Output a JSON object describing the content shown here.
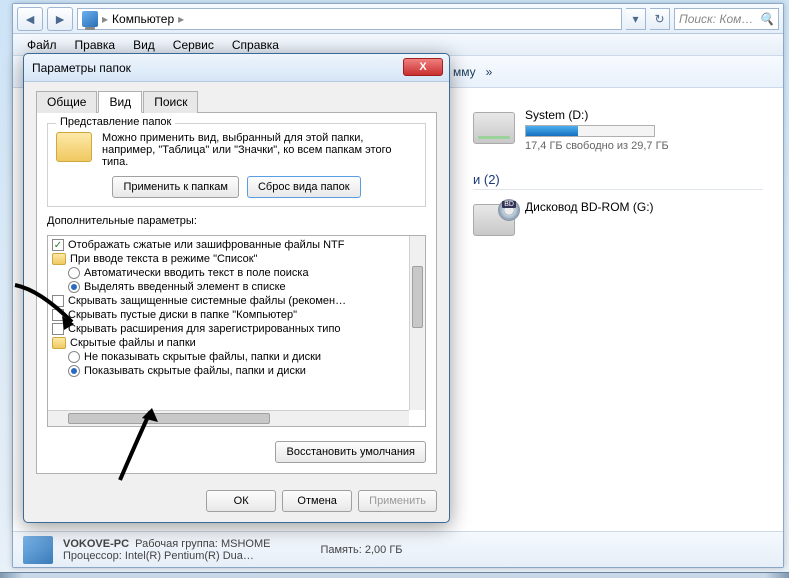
{
  "address": {
    "location": "Компьютер",
    "chevron": "▸"
  },
  "search": {
    "placeholder": "Поиск: Ком…"
  },
  "menu": {
    "file": "Файл",
    "edit": "Правка",
    "view": "Вид",
    "tools": "Сервис",
    "help": "Справка"
  },
  "toolbar": {
    "overflow": "»"
  },
  "groups": {
    "devices": "и (2)"
  },
  "driveD": {
    "name": "System (D:)",
    "free": "17,4 ГБ свободно из 29,7 ГБ",
    "usedPercent": 41
  },
  "driveG": {
    "name": "Дисковод BD-ROM (G:)"
  },
  "status": {
    "name": "VOKOVE-PC",
    "workgroupLabel": "Рабочая группа:",
    "workgroup": "MSHOME",
    "cpuLabel": "Процессор:",
    "cpu": "Intel(R) Pentium(R) Dua…",
    "ramLabel": "Память:",
    "ram": "2,00 ГБ"
  },
  "dialog": {
    "title": "Параметры папок",
    "tabs": {
      "general": "Общие",
      "view": "Вид",
      "search": "Поиск"
    },
    "representLegend": "Представление папок",
    "representText": "Можно применить вид, выбранный для этой папки, например, \"Таблица\" или \"Значки\", ко всем папкам этого типа.",
    "applyToFolders": "Применить к папкам",
    "resetFolders": "Сброс вида папок",
    "advancedLabel": "Дополнительные параметры:",
    "opts": {
      "o1": "Отображать сжатые или зашифрованные файлы NTF",
      "o2": "При вводе текста в режиме \"Список\"",
      "o2a": "Автоматически вводить текст в поле поиска",
      "o2b": "Выделять введенный элемент в списке",
      "o3": "Скрывать защищенные системные файлы (рекомен…",
      "o4": "Скрывать пустые диски в папке \"Компьютер\"",
      "o5": "Скрывать расширения для зарегистрированных типо",
      "o6": "Скрытые файлы и папки",
      "o6a": "Не показывать скрытые файлы, папки и диски",
      "o6b": "Показывать скрытые файлы, папки и диски"
    },
    "restoreDefaults": "Восстановить умолчания",
    "ok": "ОК",
    "cancel": "Отмена",
    "apply": "Применить"
  },
  "overflowText": "мму"
}
